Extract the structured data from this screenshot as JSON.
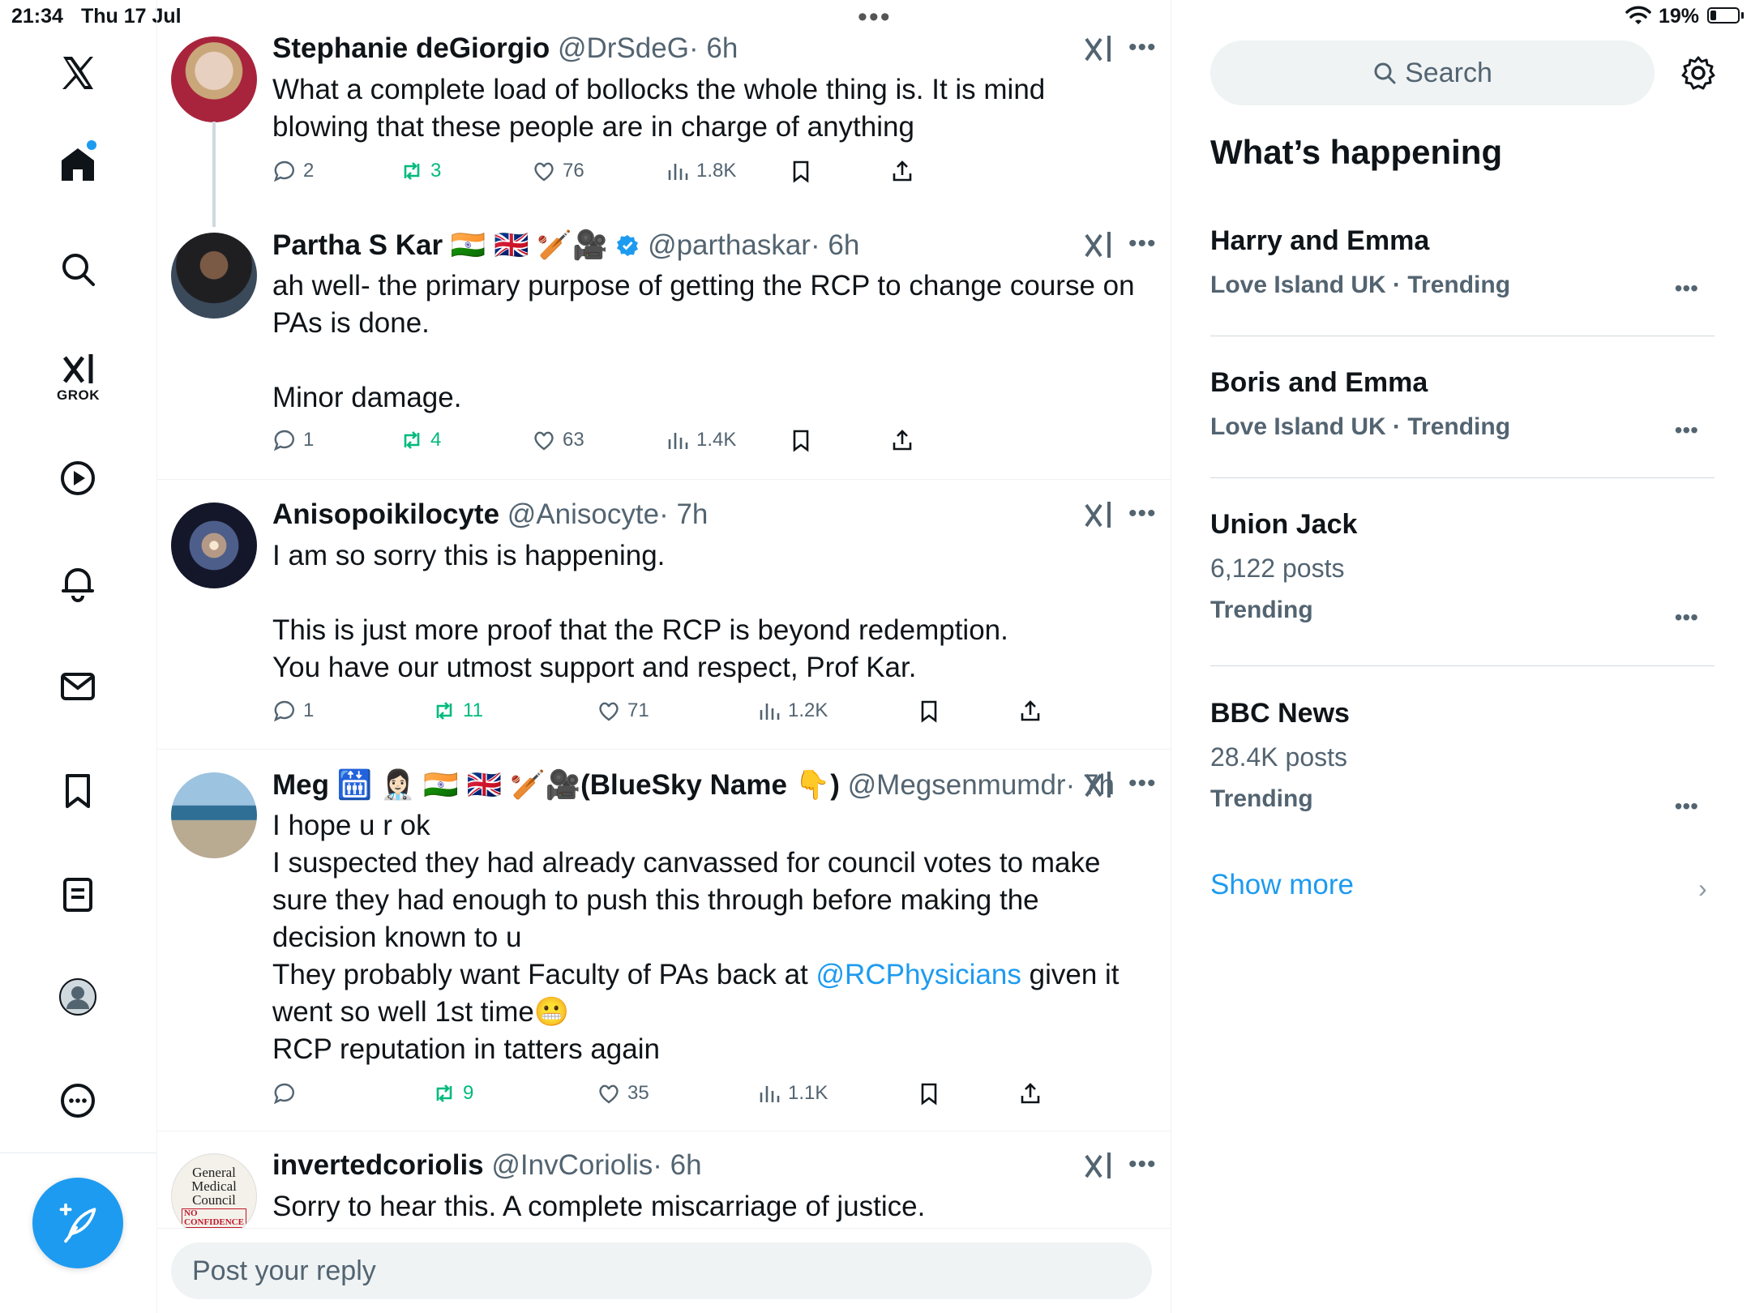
{
  "status_bar": {
    "time": "21:34",
    "date": "Thu 17 Jul",
    "battery": "19%",
    "battery_level": 0.19
  },
  "nav": {
    "grok_label": "GROK",
    "items": [
      "x-logo",
      "home",
      "search",
      "grok",
      "video",
      "notifications",
      "messages",
      "bookmarks",
      "lists",
      "profile",
      "more"
    ]
  },
  "tweets": [
    {
      "name": "Stephanie deGiorgio",
      "handle": "@DrSdeG",
      "time": "· 6h",
      "text": "What a complete load of bollocks the whole thing is. It is mind blowing that these people are in charge of anything",
      "replies": "2",
      "retweets": "3",
      "likes": "76",
      "views": "1.8K"
    },
    {
      "name": "Partha S Kar",
      "name_emoji": "🇮🇳 🇬🇧 🏏🎥",
      "handle": "@parthaskar",
      "time": "· 6h",
      "text": "ah well- the primary purpose of getting the RCP to change course on PAs is done.\n\nMinor damage.",
      "replies": "1",
      "retweets": "4",
      "likes": "63",
      "views": "1.4K"
    },
    {
      "name": "Anisopoikilocyte",
      "handle": "@Anisocyte",
      "time": "· 7h",
      "text": "I am so sorry this is happening.\n\nThis is just more proof that the RCP is beyond redemption.\nYou have our utmost support and respect, Prof Kar.",
      "replies": "1",
      "retweets": "11",
      "likes": "71",
      "views": "1.2K"
    },
    {
      "name": "Meg",
      "name_emoji": "🛗 👩🏻‍⚕️ 🇮🇳 🇬🇧 🏏🎥",
      "name_suffix": "(BlueSky Name 👇)",
      "handle": "@Megsenmumdr",
      "time": "· 7h",
      "text_a": "I hope u r ok\nI suspected they had already canvassed for council votes to make sure they had enough to push this through before making the decision known to u\nThey probably want Faculty of PAs back at ",
      "mention": "@RCPhysicians",
      "text_b": " given it went so well 1st time😬\nRCP reputation in tatters again",
      "replies": "",
      "retweets": "9",
      "likes": "35",
      "views": "1.1K"
    },
    {
      "name": "invertedcoriolis",
      "handle": "@InvCoriolis",
      "time": "· 6h",
      "text": "Sorry to hear this. A complete miscarriage of justice.",
      "avatar_text": [
        "General",
        "Medical",
        "Council",
        "NO",
        "CONFIDENCE"
      ]
    }
  ],
  "reply_placeholder": "Post your reply",
  "sidebar": {
    "search_label": "Search",
    "heading": "What’s happening",
    "trends": [
      {
        "title": "Harry and Emma",
        "meta": "Love Island UK · Trending"
      },
      {
        "title": "Boris and Emma",
        "meta": "Love Island UK · Trending"
      },
      {
        "title": "Union Jack",
        "count": "6,122 posts",
        "meta": "Trending"
      },
      {
        "title": "BBC News",
        "count": "28.4K posts",
        "meta": "Trending"
      }
    ],
    "show_more": "Show more"
  },
  "colors": {
    "accent": "#1d9bf0",
    "retweet": "#00ba7c",
    "muted": "#536471",
    "text": "#0f1419"
  }
}
